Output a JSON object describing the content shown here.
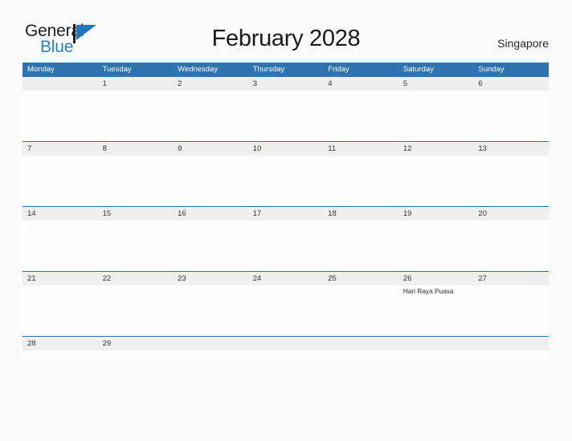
{
  "brand": {
    "name_part1": "General",
    "name_part2": "Blue",
    "flag_icon": "flag-triangle-icon",
    "accent_color": "#2980c4"
  },
  "header": {
    "title": "February 2028",
    "country": "Singapore"
  },
  "theme": {
    "header_blue": "#2e72b0",
    "date_band_gray": "#efefef",
    "page_background": "#fbfbfb",
    "cell_background": "#fdfdfd"
  },
  "calendar": {
    "month": "February",
    "year": "2028",
    "weekday_headers": [
      "Monday",
      "Tuesday",
      "Wednesday",
      "Thursday",
      "Friday",
      "Saturday",
      "Sunday"
    ],
    "weeks": [
      {
        "days": [
          {
            "date": "",
            "events": []
          },
          {
            "date": "1",
            "events": []
          },
          {
            "date": "2",
            "events": []
          },
          {
            "date": "3",
            "events": []
          },
          {
            "date": "4",
            "events": []
          },
          {
            "date": "5",
            "events": []
          },
          {
            "date": "6",
            "events": []
          }
        ]
      },
      {
        "days": [
          {
            "date": "7",
            "events": []
          },
          {
            "date": "8",
            "events": []
          },
          {
            "date": "9",
            "events": []
          },
          {
            "date": "10",
            "events": []
          },
          {
            "date": "11",
            "events": []
          },
          {
            "date": "12",
            "events": []
          },
          {
            "date": "13",
            "events": []
          }
        ]
      },
      {
        "days": [
          {
            "date": "14",
            "events": []
          },
          {
            "date": "15",
            "events": []
          },
          {
            "date": "16",
            "events": []
          },
          {
            "date": "17",
            "events": []
          },
          {
            "date": "18",
            "events": []
          },
          {
            "date": "19",
            "events": []
          },
          {
            "date": "20",
            "events": []
          }
        ]
      },
      {
        "days": [
          {
            "date": "21",
            "events": []
          },
          {
            "date": "22",
            "events": []
          },
          {
            "date": "23",
            "events": []
          },
          {
            "date": "24",
            "events": []
          },
          {
            "date": "25",
            "events": []
          },
          {
            "date": "26",
            "events": [
              "Hari Raya Puasa"
            ]
          },
          {
            "date": "27",
            "events": []
          }
        ]
      },
      {
        "days": [
          {
            "date": "28",
            "events": []
          },
          {
            "date": "29",
            "events": []
          },
          {
            "date": "",
            "events": []
          },
          {
            "date": "",
            "events": []
          },
          {
            "date": "",
            "events": []
          },
          {
            "date": "",
            "events": []
          },
          {
            "date": "",
            "events": []
          }
        ]
      }
    ]
  }
}
